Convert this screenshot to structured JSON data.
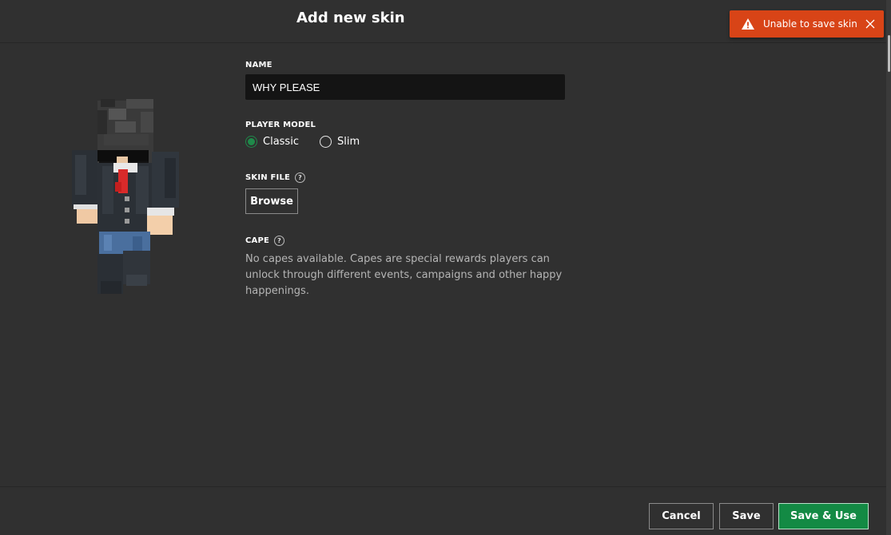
{
  "dialog": {
    "title": "Add new skin"
  },
  "toast": {
    "message": "Unable to save skin",
    "icon": "warning-icon",
    "close_icon": "close-icon",
    "color": "#d84417"
  },
  "form": {
    "name_label": "NAME",
    "name_value": "WHY PLEASE",
    "model_label": "PLAYER MODEL",
    "model_options": [
      {
        "label": "Classic",
        "selected": true
      },
      {
        "label": "Slim",
        "selected": false
      }
    ],
    "skin_file_label": "SKIN FILE",
    "help_glyph": "?",
    "browse_label": "Browse",
    "cape_label": "CAPE",
    "cape_text": "No capes available. Capes are special rewards players can unlock through different events, campaigns and other happy happenings."
  },
  "footer": {
    "cancel_label": "Cancel",
    "save_label": "Save",
    "save_use_label": "Save & Use"
  },
  "colors": {
    "background": "#303030",
    "accent": "#138a44",
    "input_bg": "#141414"
  }
}
